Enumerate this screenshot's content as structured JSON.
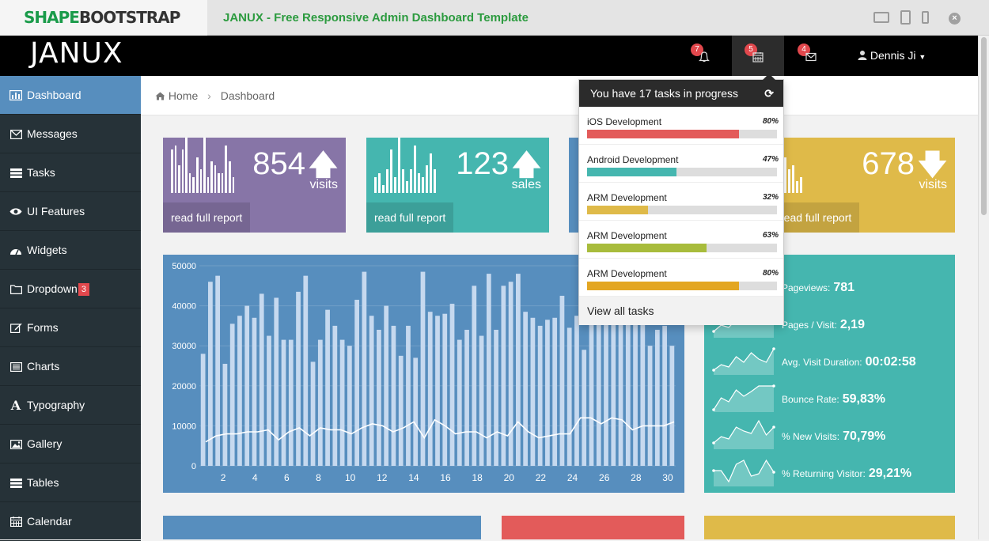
{
  "topbar": {
    "brand_a": "SHAPE",
    "brand_b": "BOOTSTRAP",
    "title": "JANUX - Free Responsive Admin Dashboard Template"
  },
  "navbar": {
    "logo": "JANUX",
    "notifications_count": "7",
    "tasks_count": "5",
    "messages_count": "4",
    "user_name": "Dennis Ji"
  },
  "sidebar": {
    "items": [
      {
        "label": "Dashboard",
        "icon": "bar-chart-icon"
      },
      {
        "label": "Messages",
        "icon": "envelope-icon"
      },
      {
        "label": "Tasks",
        "icon": "tasks-icon"
      },
      {
        "label": "UI Features",
        "icon": "eye-icon"
      },
      {
        "label": "Widgets",
        "icon": "dashboard-icon"
      },
      {
        "label": "Dropdown",
        "icon": "folder-icon",
        "badge": "3"
      },
      {
        "label": "Forms",
        "icon": "edit-icon"
      },
      {
        "label": "Charts",
        "icon": "list-alt-icon"
      },
      {
        "label": "Typography",
        "icon": "font-icon"
      },
      {
        "label": "Gallery",
        "icon": "picture-icon"
      },
      {
        "label": "Tables",
        "icon": "table-icon"
      },
      {
        "label": "Calendar",
        "icon": "calendar-icon"
      }
    ]
  },
  "breadcrumb": {
    "home": "Home",
    "current": "Dashboard"
  },
  "stats": [
    {
      "value": "854",
      "label": "visits",
      "link": "read full report",
      "direction": "up",
      "color": "#8775a7"
    },
    {
      "value": "123",
      "label": "sales",
      "link": "read full report",
      "direction": "up",
      "color": "#45b6af"
    },
    {
      "value": "",
      "label": "",
      "link": "",
      "direction": "up",
      "color": "#578ebe"
    },
    {
      "value": "678",
      "label": "visits",
      "link": "read full report",
      "direction": "down",
      "color": "#dfba49"
    }
  ],
  "metrics": [
    {
      "label": "Pageviews:",
      "value": "781"
    },
    {
      "label": "Pages / Visit:",
      "value": "2,19"
    },
    {
      "label": "Avg. Visit Duration:",
      "value": "00:02:58"
    },
    {
      "label": "Bounce Rate:",
      "value": "59,83%"
    },
    {
      "label": "% New Visits:",
      "value": "70,79%"
    },
    {
      "label": "% Returning Visitor:",
      "value": "29,21%"
    }
  ],
  "tasks_dropdown": {
    "header": "You have 17 tasks in progress",
    "footer": "View all tasks",
    "tasks": [
      {
        "name": "iOS Development",
        "percent": "80%",
        "fraction": 0.8,
        "color": "#e35b5a"
      },
      {
        "name": "Android Development",
        "percent": "47%",
        "fraction": 0.47,
        "color": "#45b6af"
      },
      {
        "name": "ARM Development",
        "percent": "32%",
        "fraction": 0.32,
        "color": "#dfba49"
      },
      {
        "name": "ARM Development",
        "percent": "63%",
        "fraction": 0.63,
        "color": "#a8bc3c"
      },
      {
        "name": "ARM Development",
        "percent": "80%",
        "fraction": 0.8,
        "color": "#e3a622"
      }
    ]
  },
  "chart_data": {
    "type": "bar",
    "ylim": [
      0,
      50000
    ],
    "yticks": [
      0,
      10000,
      20000,
      30000,
      40000,
      50000
    ],
    "xticks": [
      2,
      4,
      6,
      8,
      10,
      12,
      14,
      16,
      18,
      20,
      22,
      24,
      26,
      28,
      30
    ],
    "xlim": [
      0.5,
      30.5
    ],
    "series": [
      {
        "values": [
          28000,
          46000,
          47500,
          25500,
          35500,
          37500,
          40000,
          37000,
          43000,
          32500,
          42000,
          31500,
          31500,
          43500,
          47500,
          26000,
          31500,
          39000,
          35000,
          31500,
          30000,
          41500,
          48500,
          37500,
          34000,
          40000,
          35000,
          27500,
          35000,
          27000,
          48500,
          38500,
          37500,
          38000,
          40500,
          31500,
          34000,
          45000,
          32500,
          48000,
          34000,
          45000,
          46000,
          48000,
          38500,
          37000,
          35000,
          36500,
          37000,
          42500,
          34500,
          37500,
          29000,
          43000,
          45000,
          40000,
          38500,
          42500,
          47000,
          37000,
          41000,
          30000,
          34000,
          35000,
          30000
        ]
      },
      {
        "values": [
          6000,
          7500,
          8000,
          8000,
          8500,
          8500,
          9000,
          6500,
          8500,
          9500,
          7500,
          9500,
          9000,
          9000,
          8000,
          9500,
          10500,
          10000,
          8500,
          9500,
          11000,
          7000,
          11500,
          10000,
          8000,
          8500,
          8500,
          7000,
          8500,
          7500,
          11000,
          8500,
          7000,
          7500,
          8000,
          8000,
          12000,
          12000,
          10500,
          12000,
          11500,
          9000,
          10000,
          10000,
          10000,
          11000
        ]
      }
    ]
  }
}
